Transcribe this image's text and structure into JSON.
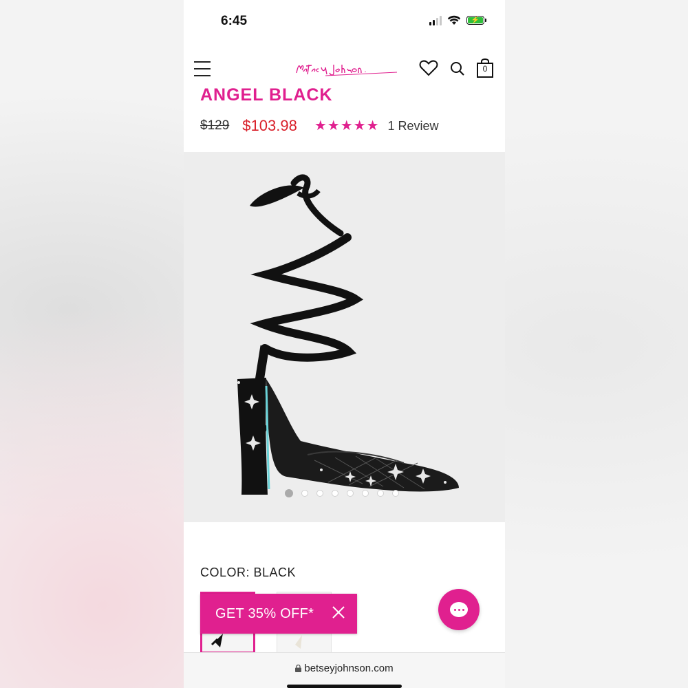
{
  "status": {
    "time": "6:45",
    "battery_color": "#2fbf3a"
  },
  "header": {
    "brand": "Betsey Johnson",
    "menu_icon": "hamburger-menu-icon",
    "wishlist_icon": "heart-icon",
    "search_icon": "search-icon",
    "bag_icon": "shopping-bag-icon",
    "bag_count": "0"
  },
  "product": {
    "title": "ANGEL BLACK",
    "original_price": "$129",
    "sale_price": "$103.98",
    "rating": 5,
    "review_count": "1 Review",
    "gallery": {
      "total_images": 8,
      "active_index": 0
    },
    "color_label": "COLOR: BLACK",
    "swatches": [
      "black",
      "white"
    ]
  },
  "promo": {
    "text": "GET 35% OFF*",
    "close_icon": "close-icon"
  },
  "chat": {
    "icon": "chat-bubble-icon"
  },
  "browser": {
    "url": "betseyjohnson.com",
    "lock_icon": "lock-icon"
  },
  "colors": {
    "brand_pink": "#e0208f",
    "sale_red": "#d9202a"
  }
}
